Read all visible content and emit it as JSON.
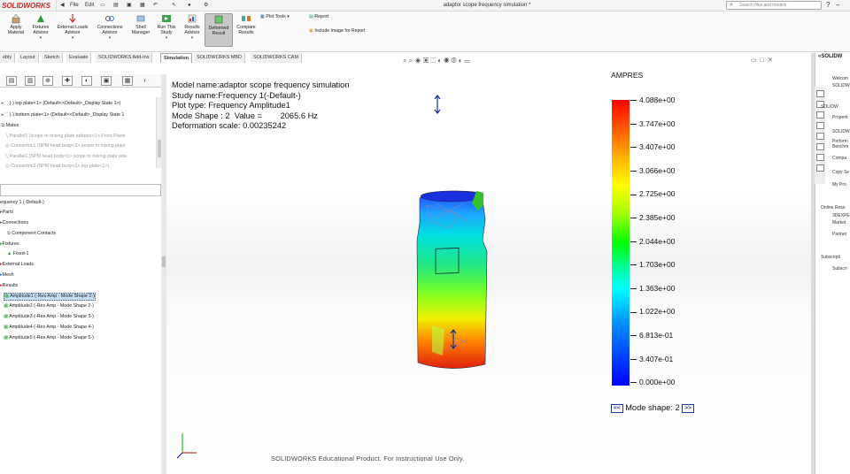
{
  "app": {
    "logo": "SOLIDWORKS",
    "window_title": "adaptor scope frequency simulation *"
  },
  "quick_access": {
    "file": "File",
    "edit": "Edit"
  },
  "search": {
    "placeholder": "Search files and models"
  },
  "ribbon": {
    "apply_material": "Apply\nMaterial",
    "fixtures_advisor": "Fixtures\nAdvisor",
    "external_loads_advisor": "External Loads\nAdvisor",
    "connections_advisor": "Connections\nAdvisor",
    "shell_manager": "Shell\nManager",
    "run_study": "Run This\nStudy",
    "results_advisor": "Results\nAdvisor",
    "deformed_result": "Deformed\nResult",
    "compare_results": "Compare\nResults",
    "plot_tools": "Plot Tools",
    "report": "Report",
    "include_image": "Include Image for Report"
  },
  "tabs": [
    "ebly",
    "Layout",
    "Sketch",
    "Evaluate",
    "SOLIDWORKS Add-Ins",
    "Simulation",
    "SOLIDWORKS MBD",
    "SOLIDWORKS CAM"
  ],
  "active_tab": "Simulation",
  "feature_tree": [
    "(-) top plate<1> (Default<<Default>_Display State 1>)",
    "(-) bottom plate<1> (Default<<Default>_Display State 1",
    "Mates",
    "Parallel1 (scope to mixing plate adaptor<1>,Front Plane",
    "Concentric1 (SPM head body<1>,scope to mixing plate",
    "Parallel1 (SPM head body<1>,scope to mixing plate ada",
    "Concentric2 (SPM head body<1>,top plate<1>)"
  ],
  "study_tree": {
    "study": "equency 1 (-Default-)",
    "items": [
      "Parts",
      "Connections",
      "Component Contacts",
      "Fixtures",
      "Fixed-1",
      "External Loads",
      "Mesh",
      "Results"
    ],
    "results": [
      "Amplitude1 (-Res Amp - Mode Shape 2-)",
      "Amplitude2 (-Res Amp - Mode Shape 2-)",
      "Amplitude3 (-Res Amp - Mode Shape 3-)",
      "Amplitude4 (-Res Amp - Mode Shape 4-)",
      "Amplitude5 (-Res Amp - Mode Shape 5-)"
    ]
  },
  "plot_info": {
    "model_name": "Model name:adaptor scope frequency simulation",
    "study_name": "Study name:Frequency 1(-Default-)",
    "plot_type": "Plot type: Frequency Amplitude1",
    "mode_shape": "Mode Shape : 2  Value =        2065.6 Hz",
    "deformation_scale": "Deformation scale: 0.00235242"
  },
  "legend": {
    "title": "AMPRES",
    "ticks": [
      "4.088e+00",
      "3.747e+00",
      "3.407e+00",
      "3.066e+00",
      "2.725e+00",
      "2.385e+00",
      "2.044e+00",
      "1.703e+00",
      "1.363e+00",
      "1.022e+00",
      "6.813e-01",
      "3.407e-01",
      "0.000e+00"
    ],
    "colors": [
      "#ff0000",
      "#ffff00",
      "#00ff00",
      "#00ffff",
      "#0000ff"
    ]
  },
  "mode_nav": {
    "prev": "<<",
    "label": "Mode shape: 2",
    "next": ">>"
  },
  "watermark": "SOLIDWORKS Educational Product. For Instructional Use Only.",
  "task_pane": {
    "header": "SOLIDW",
    "items": [
      "Welcom",
      "SOLIDW",
      "SOLIDW",
      "Properti",
      "SOLIDW",
      "Perform",
      "Benchm",
      "Compa",
      "Copy Se",
      "My Pro",
      "Online Reso",
      "3DEXPE",
      "Market",
      "Partner",
      "Subscripti",
      "Subscri"
    ]
  }
}
